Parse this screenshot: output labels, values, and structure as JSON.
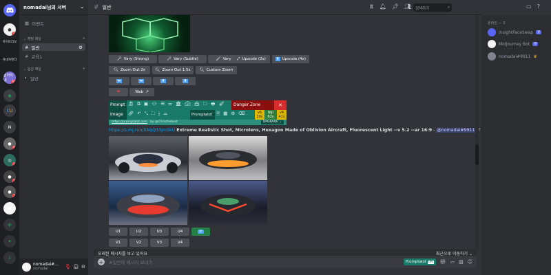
{
  "server_rail": {
    "server_labels": [
      "아이토리보",
      "자네자엔더",
      "남어지내"
    ],
    "badges": [
      "1",
      "64",
      "9",
      "2",
      "1",
      "2"
    ]
  },
  "server": {
    "name": "nomadai님의 서버"
  },
  "sidebar": {
    "events": "이벤트",
    "text_category": "채팅 채널",
    "channels": [
      "일반",
      "교육1"
    ],
    "voice_category": "음성 채널",
    "voice_channels": [
      "일반"
    ]
  },
  "user_panel": {
    "name": "nomadai#...",
    "tag": "nomadai"
  },
  "topbar": {
    "channel": "일반",
    "search_placeholder": "검색하기"
  },
  "buttons_row1": [
    "Vary (Strong)",
    "Vary (Subtle)",
    "Vary (Region)",
    "Upscale (2x)",
    "Upscale (4x)"
  ],
  "buttons_row2": [
    "Zoom Out 2x",
    "Zoom Out 1.5x",
    "Custom Zoom"
  ],
  "buttons_row4": {
    "web": "Web"
  },
  "extension": {
    "prompt": "Prompt",
    "image": "Image",
    "promptalot": "Promptalot",
    "danger_zone": "Danger Zone",
    "versions": [
      "v6",
      "Niji",
      "v4"
    ],
    "version_subs": [
      "20s",
      "62s",
      "41s"
    ],
    "upgrade": "UPGRADE",
    "footer_link": "https://promptalot.com",
    "footer_note": "by @Christhebest"
  },
  "message": {
    "link": "https://s.mj.run/SNqQ33jmSkU",
    "prompt": "Extreme Realistic Shot, Microlens, Hexagon Made of Oblivion Aircraft, Fluorescent Light --v 5.2 --ar 16:9",
    "dash": " - ",
    "mention": "@nomadai#9911",
    "mode": "(fast)"
  },
  "u_buttons": [
    "U1",
    "U2",
    "U3",
    "U4"
  ],
  "v_buttons": [
    "V1",
    "V2",
    "V3",
    "V4"
  ],
  "new_messages": {
    "text": "오래된 메시지를 보고 있어요",
    "jump": "최근으로 이동하기"
  },
  "composer": {
    "placeholder": "#일반에 메시지 보내기",
    "promptalot": "Promptalot",
    "promptalot_tag": "ON"
  },
  "members": {
    "category": "온라인 — 3",
    "list": [
      {
        "name": "InsightFaceSwap",
        "bot": "봇"
      },
      {
        "name": "Midjourney Bot",
        "bot": "봇"
      },
      {
        "name": "nomadai#9911",
        "bot": ""
      }
    ]
  },
  "colors": {
    "accent": "#5865f2",
    "green": "#248046",
    "danger": "#f23f43",
    "highlight": "#f0b232"
  }
}
